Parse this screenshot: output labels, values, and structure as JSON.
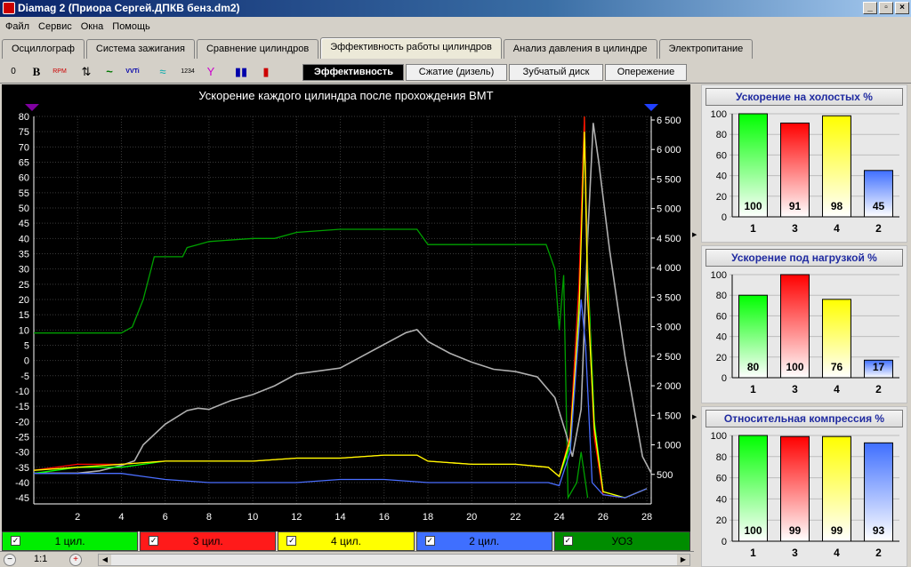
{
  "window": {
    "title": "Diamag 2 (Приора Сергей.ДПКВ бенз.dm2)",
    "buttons": [
      "_",
      "▫",
      "×"
    ]
  },
  "menu": [
    "Файл",
    "Сервис",
    "Окна",
    "Помощь"
  ],
  "tabs": [
    "Осциллограф",
    "Система зажигания",
    "Сравнение цилиндров",
    "Эффективность работы цилиндров",
    "Анализ давления в цилиндре",
    "Электропитание"
  ],
  "active_tab": 3,
  "toolbar": {
    "tools": [
      "0",
      "B",
      "RPM",
      "⇅",
      "~",
      "VVTi",
      "≈",
      "1234",
      "Y",
      "▮▮",
      "▮"
    ]
  },
  "subtabs": [
    "Эффективность",
    "Сжатие (дизель)",
    "Зубчатый диск",
    "Опережение"
  ],
  "active_subtab": 0,
  "main_chart": {
    "title": "Ускорение каждого цилиндра после прохождения ВМТ",
    "y_left_ticks": [
      "80",
      "75",
      "70",
      "65",
      "60",
      "55",
      "50",
      "45",
      "40",
      "35",
      "30",
      "25",
      "20",
      "15",
      "10",
      "5",
      "0",
      "-5",
      "-10",
      "-15",
      "-20",
      "-25",
      "-30",
      "-35",
      "-40",
      "-45"
    ],
    "y_right_ticks": [
      "6 500",
      "6 000",
      "5 500",
      "5 000",
      "4 500",
      "4 000",
      "3 500",
      "3 000",
      "2 500",
      "2 000",
      "1 500",
      "1 000",
      "500"
    ],
    "x_ticks": [
      "2",
      "4",
      "6",
      "8",
      "10",
      "12",
      "14",
      "16",
      "18",
      "20",
      "22",
      "24",
      "26",
      "28"
    ]
  },
  "chart_data": {
    "type": "line",
    "title": "Ускорение каждого цилиндра после прохождения ВМТ",
    "xlabel": "",
    "ylabel": "",
    "xlim": [
      0,
      28.2
    ],
    "ylim": [
      -47,
      80
    ],
    "y2lim": [
      0,
      6560
    ],
    "grid": true,
    "series": [
      {
        "name": "1 цил.",
        "color": "#00ff00",
        "axis": "left",
        "x": [
          0,
          2,
          4,
          6,
          8,
          10,
          12,
          14,
          16,
          17.5,
          18,
          20,
          22,
          23.5,
          24,
          24.5,
          24.9,
          25.15,
          25.3,
          25.6,
          26,
          27,
          28
        ],
        "y": [
          -37,
          -35,
          -35,
          -33,
          -33,
          -33,
          -32,
          -32,
          -31,
          -31,
          -33,
          -34,
          -34,
          -35,
          -38,
          -28,
          20,
          80,
          30,
          -20,
          -43,
          -45,
          -42
        ]
      },
      {
        "name": "3 цил.",
        "color": "#ff0000",
        "axis": "left",
        "x": [
          0,
          2,
          4,
          6,
          8,
          10,
          12,
          14,
          16,
          17.5,
          18,
          20,
          22,
          23.5,
          24,
          24.5,
          24.9,
          25.15,
          25.3,
          25.6,
          26,
          27,
          28
        ],
        "y": [
          -36,
          -34,
          -34,
          -33,
          -33,
          -33,
          -32,
          -32,
          -31,
          -31,
          -33,
          -34,
          -34,
          -35,
          -38,
          -25,
          25,
          80,
          25,
          -25,
          -44,
          -45,
          -42
        ]
      },
      {
        "name": "4 цил.",
        "color": "#ffff00",
        "axis": "left",
        "x": [
          0,
          2,
          4,
          6,
          8,
          10,
          12,
          14,
          16,
          17.5,
          18,
          20,
          22,
          23.5,
          24,
          24.5,
          24.9,
          25.15,
          25.3,
          25.6,
          26,
          27,
          28
        ],
        "y": [
          -36,
          -35,
          -34,
          -33,
          -33,
          -33,
          -32,
          -32,
          -31,
          -31,
          -33,
          -34,
          -34,
          -35,
          -38,
          -26,
          15,
          75,
          20,
          -22,
          -43,
          -45,
          -42
        ]
      },
      {
        "name": "2 цил.",
        "color": "#4a6eff",
        "axis": "left",
        "x": [
          0,
          2,
          4,
          5,
          6,
          8,
          10,
          12,
          14,
          16,
          18,
          20,
          22,
          23.5,
          24,
          24.5,
          25,
          25.2,
          25.5,
          26,
          27,
          28
        ],
        "y": [
          -37,
          -37,
          -37,
          -38,
          -39,
          -40,
          -40,
          -40,
          -39,
          -39,
          -40,
          -40,
          -40,
          -40,
          -41,
          -30,
          20,
          5,
          -40,
          -44,
          -45,
          -42
        ]
      },
      {
        "name": "УОЗ",
        "color": "#00a000",
        "axis": "left",
        "x": [
          0,
          2,
          4,
          4.5,
          5,
          5.5,
          6,
          6.8,
          7,
          7.5,
          8,
          10,
          11,
          12,
          14,
          16,
          17.5,
          18,
          20,
          22,
          23.4,
          23.8,
          24,
          24.2,
          24.4,
          24.8,
          25,
          25.3
        ],
        "y": [
          9,
          9,
          9,
          11,
          20,
          34,
          34,
          34,
          37,
          38,
          39,
          40,
          40,
          42,
          43,
          43,
          43,
          38,
          38,
          38,
          38,
          30,
          10,
          28,
          -45,
          -40,
          -30,
          -45
        ]
      },
      {
        "name": "",
        "color": "#b0b0b0",
        "axis": "right",
        "x": [
          0,
          2,
          3,
          4,
          4.6,
          5,
          6,
          7,
          7.5,
          8,
          9,
          10,
          11,
          12,
          14,
          15,
          16,
          17,
          17.5,
          18,
          19,
          20,
          21,
          22,
          23,
          23.8,
          24.3,
          24.6,
          25,
          25.3,
          25.55,
          25.8,
          26.3,
          27,
          27.8,
          28.2
        ],
        "y": [
          520,
          520,
          560,
          650,
          730,
          1000,
          1350,
          1580,
          1620,
          1600,
          1750,
          1850,
          2000,
          2200,
          2300,
          2500,
          2700,
          2900,
          2950,
          2750,
          2550,
          2400,
          2280,
          2240,
          2150,
          1800,
          1200,
          800,
          1600,
          4500,
          6450,
          5800,
          4300,
          2500,
          800,
          520
        ]
      }
    ]
  },
  "legend": [
    {
      "label": "1 цил.",
      "color": "#00ee00",
      "checked": "✓"
    },
    {
      "label": "3 цил.",
      "color": "#ff1a1a",
      "checked": "✓"
    },
    {
      "label": "4 цил.",
      "color": "#ffff00",
      "checked": "✓"
    },
    {
      "label": "2 цил.",
      "color": "#3f6fff",
      "checked": "✓"
    },
    {
      "label": "УОЗ",
      "color": "#008c00",
      "checked": "✓"
    }
  ],
  "statusbar": {
    "zoom_minus": "−",
    "zoom_ratio": "1:1",
    "zoom_plus": "+"
  },
  "panels": [
    {
      "title": "Ускорение на холостых %",
      "chart_data": {
        "type": "bar",
        "categories": [
          "1",
          "3",
          "4",
          "2"
        ],
        "values": [
          100,
          91,
          98,
          45
        ],
        "colors": [
          "#00ff00",
          "#ff0000",
          "#ffff00",
          "#3f6fff"
        ],
        "ylim": [
          0,
          100
        ],
        "yticks": [
          "100",
          "80",
          "60",
          "40",
          "20",
          "0"
        ]
      }
    },
    {
      "title": "Ускорение под нагрузкой %",
      "chart_data": {
        "type": "bar",
        "categories": [
          "1",
          "3",
          "4",
          "2"
        ],
        "values": [
          80,
          100,
          76,
          17
        ],
        "colors": [
          "#00ff00",
          "#ff0000",
          "#ffff00",
          "#3f6fff"
        ],
        "ylim": [
          0,
          100
        ],
        "yticks": [
          "100",
          "80",
          "60",
          "40",
          "20",
          "0"
        ]
      }
    },
    {
      "title": "Относительная компрессия %",
      "chart_data": {
        "type": "bar",
        "categories": [
          "1",
          "3",
          "4",
          "2"
        ],
        "values": [
          100,
          99,
          99,
          93
        ],
        "colors": [
          "#00ff00",
          "#ff0000",
          "#ffff00",
          "#3f6fff"
        ],
        "ylim": [
          0,
          100
        ],
        "yticks": [
          "100",
          "80",
          "60",
          "40",
          "20",
          "0"
        ]
      }
    }
  ]
}
